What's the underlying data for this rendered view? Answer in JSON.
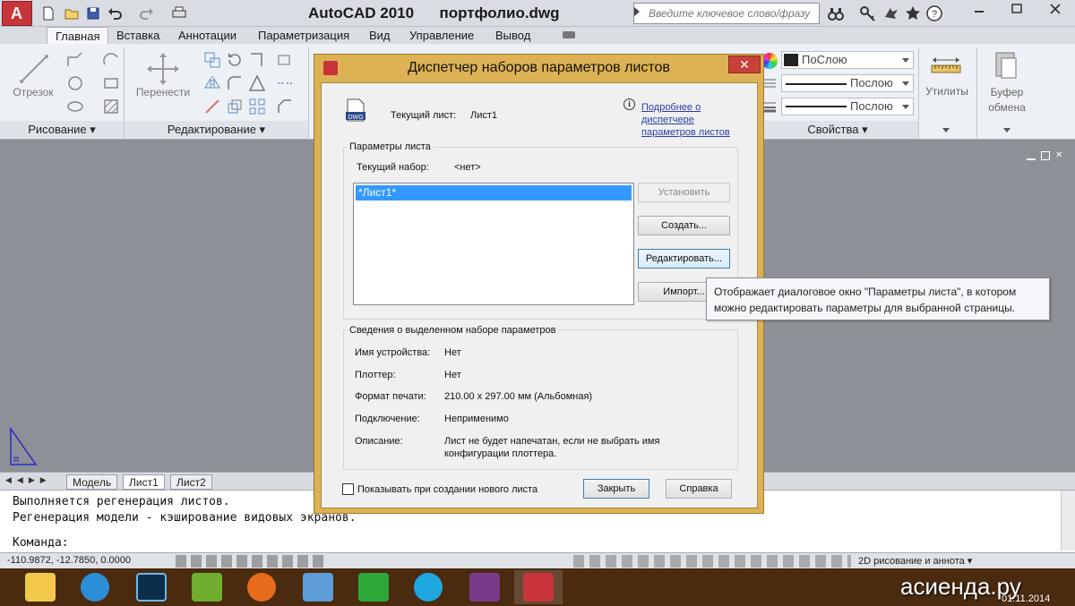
{
  "window": {
    "app_name": "AutoCAD 2010",
    "file_name": "портфолио.dwg",
    "search_placeholder": "Введите ключевое слово/фразу"
  },
  "ribbon_tabs": [
    "Главная",
    "Вставка",
    "Аннотации",
    "Параметризация",
    "Вид",
    "Управление",
    "Вывод"
  ],
  "ribbon": {
    "draw_panel": {
      "title": "Рисование",
      "big_button": "Отрезок"
    },
    "modify_panel": {
      "title": "Редактирование",
      "big_button": "Перенести"
    },
    "properties_panel": {
      "title": "Свойства",
      "color": "ПоСлою",
      "linetype": "Послою",
      "lineweight": "Послою"
    },
    "utilities": "Утилиты",
    "clipboard": "Буфер обмена"
  },
  "layout_tabs": [
    "Модель",
    "Лист1",
    "Лист2"
  ],
  "command_line": {
    "line1": "Выполняется регенерация листов.",
    "line2": "Регенерация модели - кэширование видовых экранов.",
    "prompt": "Команда:"
  },
  "status_bar": {
    "coords": "-110.9872, -12.7850, 0.0000",
    "workspace": "2D рисование и аннота"
  },
  "dialog": {
    "title": "Диспетчер наборов параметров листов",
    "current_layout_label": "Текущий лист:",
    "current_layout_value": "Лист1",
    "help_link": "Подробнее о диспетчере параметров листов",
    "help_link_lines": [
      "Подробнее о",
      "диспетчере",
      "параметров листов"
    ],
    "group1_title": "Параметры листа",
    "current_set_label": "Текущий набор:",
    "current_set_value": "<нет>",
    "list_items": [
      "*Лист1*"
    ],
    "buttons": {
      "set_current": "Установить",
      "new": "Создать...",
      "modify": "Редактировать...",
      "import": "Импорт..."
    },
    "group2_title": "Сведения о выделенном наборе параметров",
    "details": [
      {
        "label": "Имя устройства:",
        "value": "Нет"
      },
      {
        "label": "Плоттер:",
        "value": "Нет"
      },
      {
        "label": "Формат печати:",
        "value": "210.00 x 297.00 мм (Альбомная)"
      },
      {
        "label": "Подключение:",
        "value": "Неприменимо"
      },
      {
        "label": "Описание:",
        "value": "Лист не будет напечатан, если не выбрать имя"
      }
    ],
    "description_line2": "конфигурации плоттера.",
    "checkbox_label": "Показывать при создании нового листа",
    "close_button": "Закрыть",
    "help_button": "Справка"
  },
  "tooltip": {
    "line1": "Отображает диалоговое окно \"Параметры листа\", в котором",
    "line2": "можно редактировать параметры для выбранной страницы."
  },
  "watermark": {
    "text": "асиенда.ру",
    "date": "01.11.2014"
  },
  "colors": {
    "dialog_frame": "#ddb254",
    "selection": "#3399ff",
    "taskbar": "#4a2b10"
  }
}
